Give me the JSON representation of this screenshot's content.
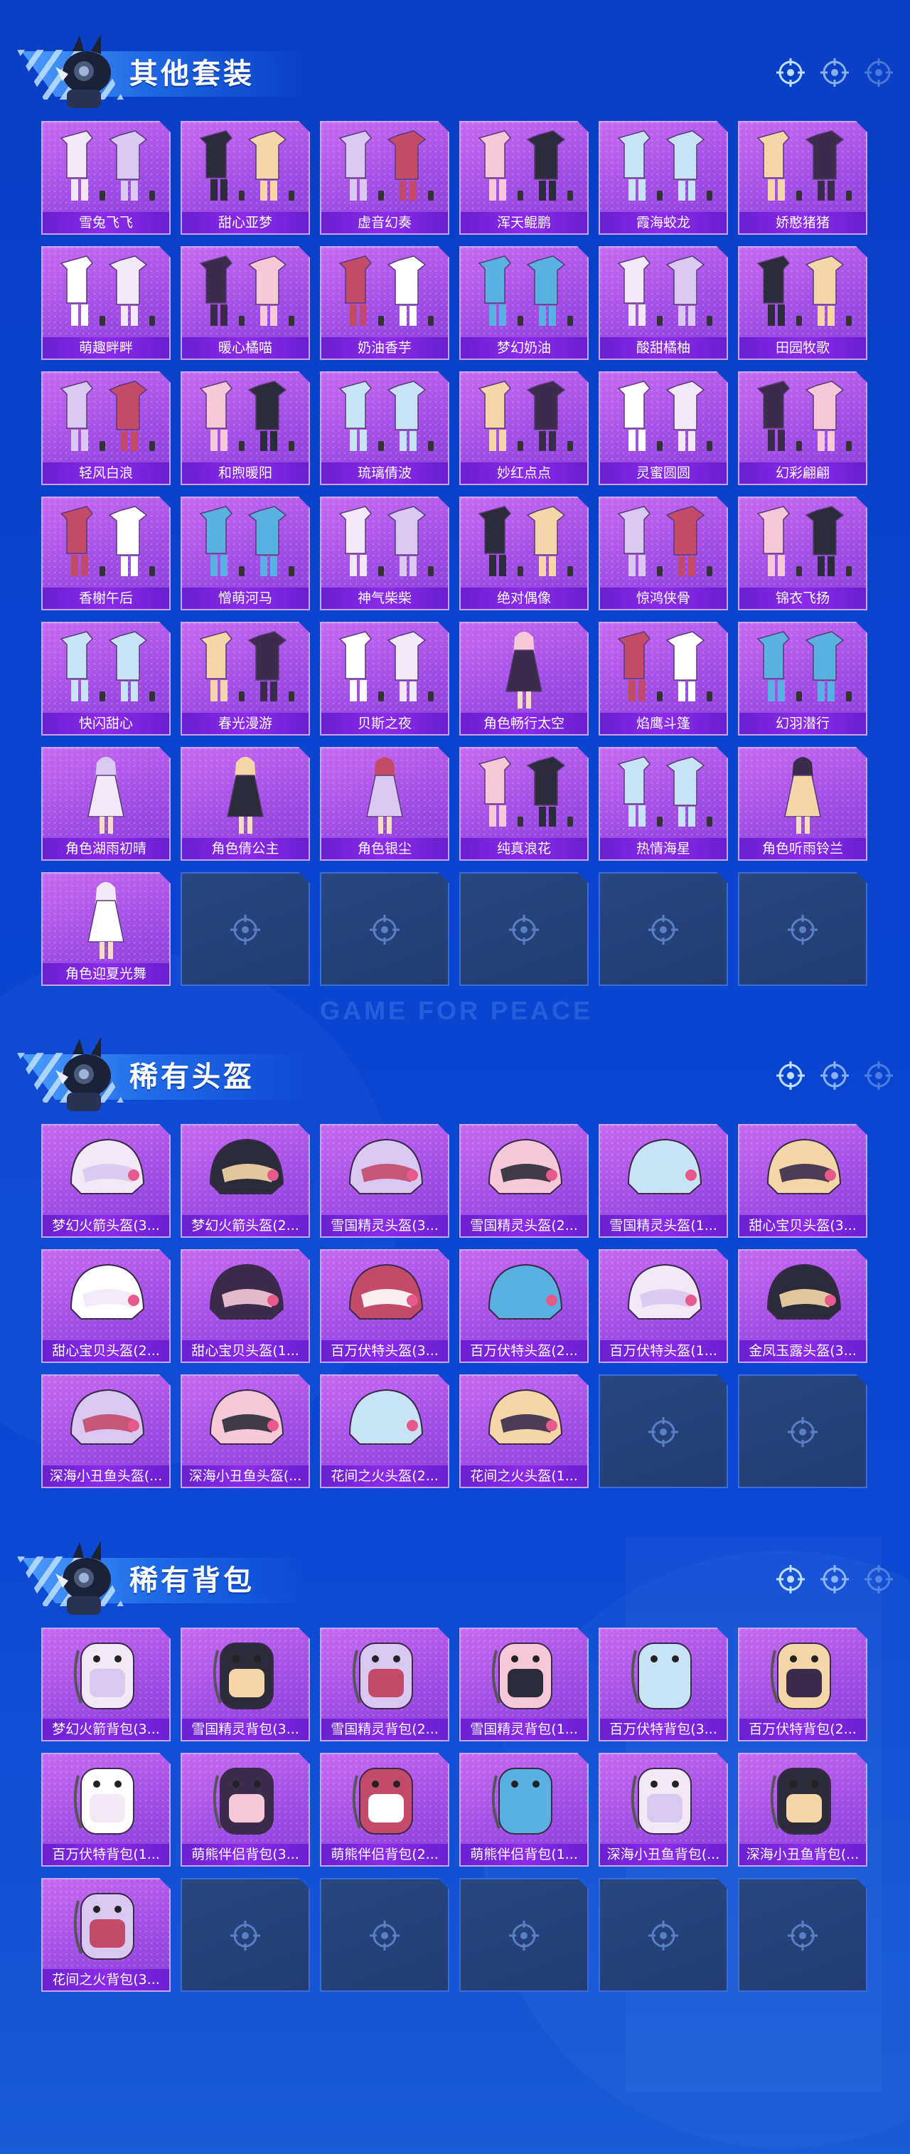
{
  "colors": {
    "background": "#0a44cf",
    "card_purple": "#a24fe6",
    "card_label": "#7a24dc",
    "card_empty": "#24427a",
    "accent_light": "#bfe0ff"
  },
  "watermark": "GAME FOR PEACE",
  "sections": [
    {
      "title": "其他套装",
      "items": [
        {
          "label": "雪兔飞飞",
          "icon": "outfit-icon"
        },
        {
          "label": "甜心亚梦",
          "icon": "outfit-icon"
        },
        {
          "label": "虚音幻奏",
          "icon": "outfit-icon"
        },
        {
          "label": "浑天鲲鹏",
          "icon": "outfit-icon"
        },
        {
          "label": "霞海蛟龙",
          "icon": "outfit-icon"
        },
        {
          "label": "娇憨猪猪",
          "icon": "outfit-icon"
        },
        {
          "label": "萌趣畔畔",
          "icon": "outfit-icon"
        },
        {
          "label": "暖心橘喵",
          "icon": "outfit-icon"
        },
        {
          "label": "奶油香芋",
          "icon": "outfit-icon"
        },
        {
          "label": "梦幻奶油",
          "icon": "outfit-icon"
        },
        {
          "label": "酸甜橘柚",
          "icon": "outfit-icon"
        },
        {
          "label": "田园牧歌",
          "icon": "outfit-icon"
        },
        {
          "label": "轻风白浪",
          "icon": "outfit-icon"
        },
        {
          "label": "和煦暖阳",
          "icon": "outfit-icon"
        },
        {
          "label": "琉璃倩波",
          "icon": "outfit-icon"
        },
        {
          "label": "妙红点点",
          "icon": "outfit-icon"
        },
        {
          "label": "灵蜜圆圆",
          "icon": "outfit-icon"
        },
        {
          "label": "幻彩翩翩",
          "icon": "outfit-icon"
        },
        {
          "label": "香榭午后",
          "icon": "outfit-icon"
        },
        {
          "label": "憎萌河马",
          "icon": "outfit-icon"
        },
        {
          "label": "神气柴柴",
          "icon": "outfit-icon"
        },
        {
          "label": "绝对偶像",
          "icon": "outfit-icon"
        },
        {
          "label": "惊鸿侠骨",
          "icon": "outfit-icon"
        },
        {
          "label": "锦衣飞扬",
          "icon": "outfit-icon"
        },
        {
          "label": "快闪甜心",
          "icon": "outfit-icon"
        },
        {
          "label": "春光漫游",
          "icon": "outfit-icon"
        },
        {
          "label": "贝斯之夜",
          "icon": "outfit-icon"
        },
        {
          "label": "角色畅行太空",
          "icon": "character-icon"
        },
        {
          "label": "焰鹰斗篷",
          "icon": "outfit-icon"
        },
        {
          "label": "幻羽潜行",
          "icon": "outfit-icon"
        },
        {
          "label": "角色湖雨初晴",
          "icon": "character-icon"
        },
        {
          "label": "角色倩公主",
          "icon": "character-icon"
        },
        {
          "label": "角色银尘",
          "icon": "character-icon"
        },
        {
          "label": "纯真浪花",
          "icon": "outfit-icon"
        },
        {
          "label": "热情海星",
          "icon": "outfit-icon"
        },
        {
          "label": "角色听雨铃兰",
          "icon": "character-icon"
        },
        {
          "label": "角色迎夏光舞",
          "icon": "character-icon"
        }
      ],
      "empty_slots": 5
    },
    {
      "title": "稀有头盔",
      "items": [
        {
          "label": "梦幻火箭头盔(3...",
          "icon": "helmet-icon"
        },
        {
          "label": "梦幻火箭头盔(2...",
          "icon": "helmet-icon"
        },
        {
          "label": "雪国精灵头盔(3...",
          "icon": "helmet-icon"
        },
        {
          "label": "雪国精灵头盔(2...",
          "icon": "helmet-icon"
        },
        {
          "label": "雪国精灵头盔(1...",
          "icon": "helmet-icon"
        },
        {
          "label": "甜心宝贝头盔(3...",
          "icon": "helmet-icon"
        },
        {
          "label": "甜心宝贝头盔(2...",
          "icon": "helmet-icon"
        },
        {
          "label": "甜心宝贝头盔(1...",
          "icon": "helmet-icon"
        },
        {
          "label": "百万伏特头盔(3...",
          "icon": "helmet-icon"
        },
        {
          "label": "百万伏特头盔(2...",
          "icon": "helmet-icon"
        },
        {
          "label": "百万伏特头盔(1...",
          "icon": "helmet-icon"
        },
        {
          "label": "金凤玉露头盔(3...",
          "icon": "helmet-icon"
        },
        {
          "label": "深海小丑鱼头盔(...",
          "icon": "helmet-icon"
        },
        {
          "label": "深海小丑鱼头盔(...",
          "icon": "helmet-icon"
        },
        {
          "label": "花间之火头盔(2...",
          "icon": "helmet-icon"
        },
        {
          "label": "花间之火头盔(1...",
          "icon": "helmet-icon"
        }
      ],
      "empty_slots": 2
    },
    {
      "title": "稀有背包",
      "items": [
        {
          "label": "梦幻火箭背包(3...",
          "icon": "backpack-icon"
        },
        {
          "label": "雪国精灵背包(3...",
          "icon": "backpack-icon"
        },
        {
          "label": "雪国精灵背包(2...",
          "icon": "backpack-icon"
        },
        {
          "label": "雪国精灵背包(1...",
          "icon": "backpack-icon"
        },
        {
          "label": "百万伏特背包(3...",
          "icon": "backpack-icon"
        },
        {
          "label": "百万伏特背包(2...",
          "icon": "backpack-icon"
        },
        {
          "label": "百万伏特背包(1...",
          "icon": "backpack-icon"
        },
        {
          "label": "萌熊伴侣背包(3...",
          "icon": "backpack-icon"
        },
        {
          "label": "萌熊伴侣背包(2...",
          "icon": "backpack-icon"
        },
        {
          "label": "萌熊伴侣背包(1...",
          "icon": "backpack-icon"
        },
        {
          "label": "深海小丑鱼背包(...",
          "icon": "backpack-icon"
        },
        {
          "label": "深海小丑鱼背包(...",
          "icon": "backpack-icon"
        },
        {
          "label": "花间之火背包(3...",
          "icon": "backpack-icon"
        }
      ],
      "empty_slots": 5
    }
  ]
}
